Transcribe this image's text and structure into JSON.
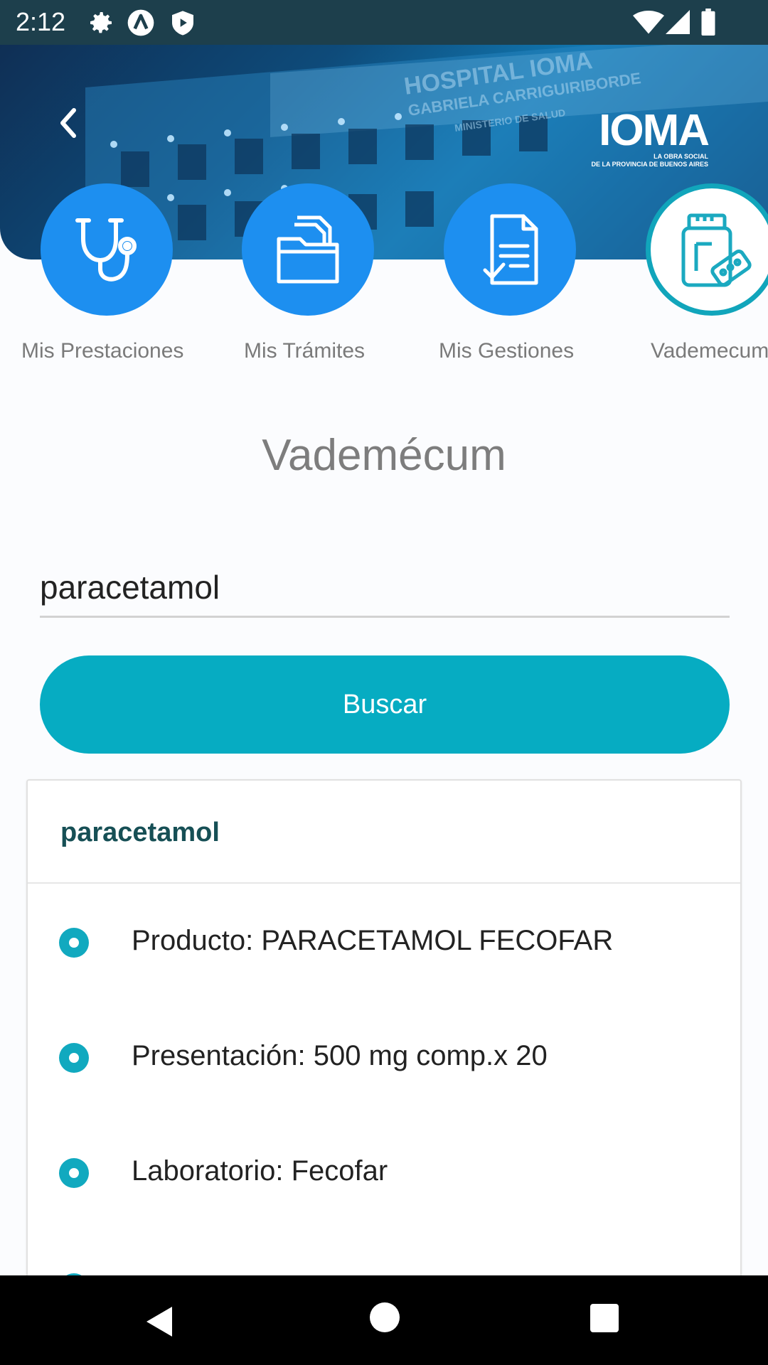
{
  "status_bar": {
    "time": "2:12",
    "icons": [
      "gear-icon",
      "a-icon",
      "shield-icon",
      "wifi-icon",
      "signal-icon",
      "battery-icon"
    ]
  },
  "header": {
    "back_icon": "chevron-left-icon",
    "logo": {
      "name": "IOMA",
      "tagline_1": "LA OBRA SOCIAL",
      "tagline_2": "DE LA PROVINCIA DE BUENOS AIRES"
    }
  },
  "categories": [
    {
      "label": "Mis Prestaciones",
      "icon": "stethoscope-icon"
    },
    {
      "label": "Mis Trámites",
      "icon": "folder-icon"
    },
    {
      "label": "Mis Gestiones",
      "icon": "document-check-icon"
    },
    {
      "label": "Vademecum",
      "icon": "pill-bottle-icon",
      "active": true
    }
  ],
  "page_title": "Vademécum",
  "search": {
    "value": "paracetamol",
    "button_label": "Buscar"
  },
  "result": {
    "title": "paracetamol",
    "items": [
      "Producto: PARACETAMOL FECOFAR",
      "Presentación: 500 mg comp.x 20",
      "Laboratorio: Fecofar"
    ]
  },
  "colors": {
    "status_bar": "#1d3f4c",
    "accent": "#06acc2",
    "category_blue": "#1d8ff0",
    "result_title": "#164f55"
  }
}
